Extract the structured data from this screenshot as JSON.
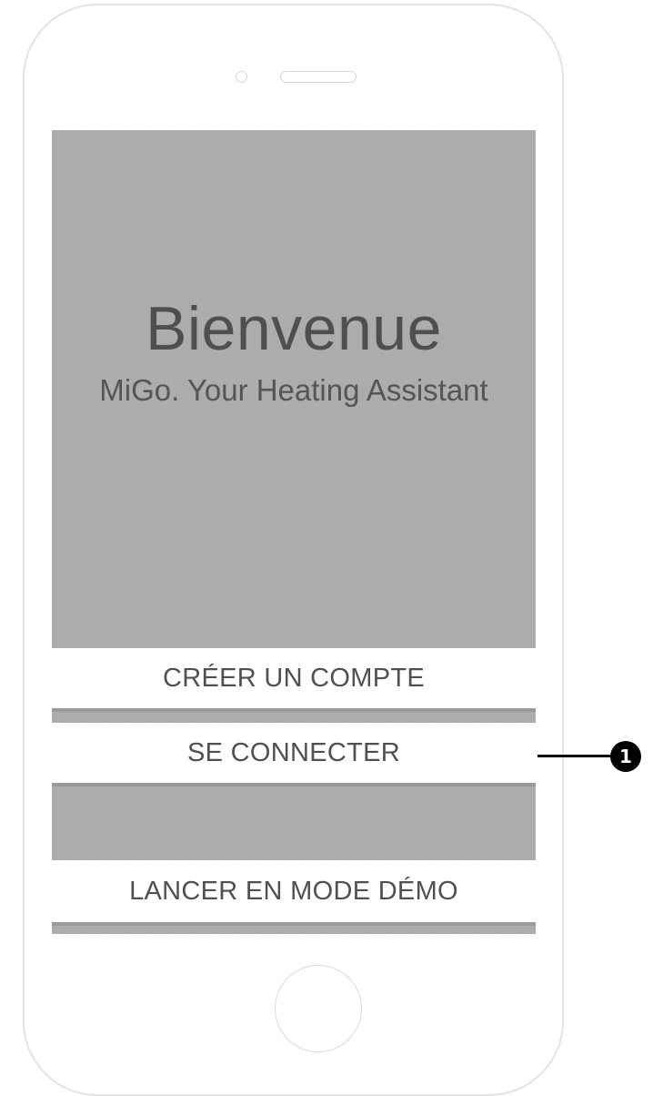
{
  "welcome": {
    "title": "Bienvenue",
    "subtitle": "MiGo. Your Heating Assistant"
  },
  "buttons": {
    "create_account": "CRÉER UN COMPTE",
    "connect": "SE CONNECTER",
    "demo": "LANCER EN MODE DÉMO"
  },
  "annotation": {
    "number": "1"
  },
  "colors": {
    "screen_background": "#ababab",
    "button_background": "#ffffff",
    "text": "#505050",
    "device_outline": "#e3e3e3",
    "callout": "#000000"
  }
}
